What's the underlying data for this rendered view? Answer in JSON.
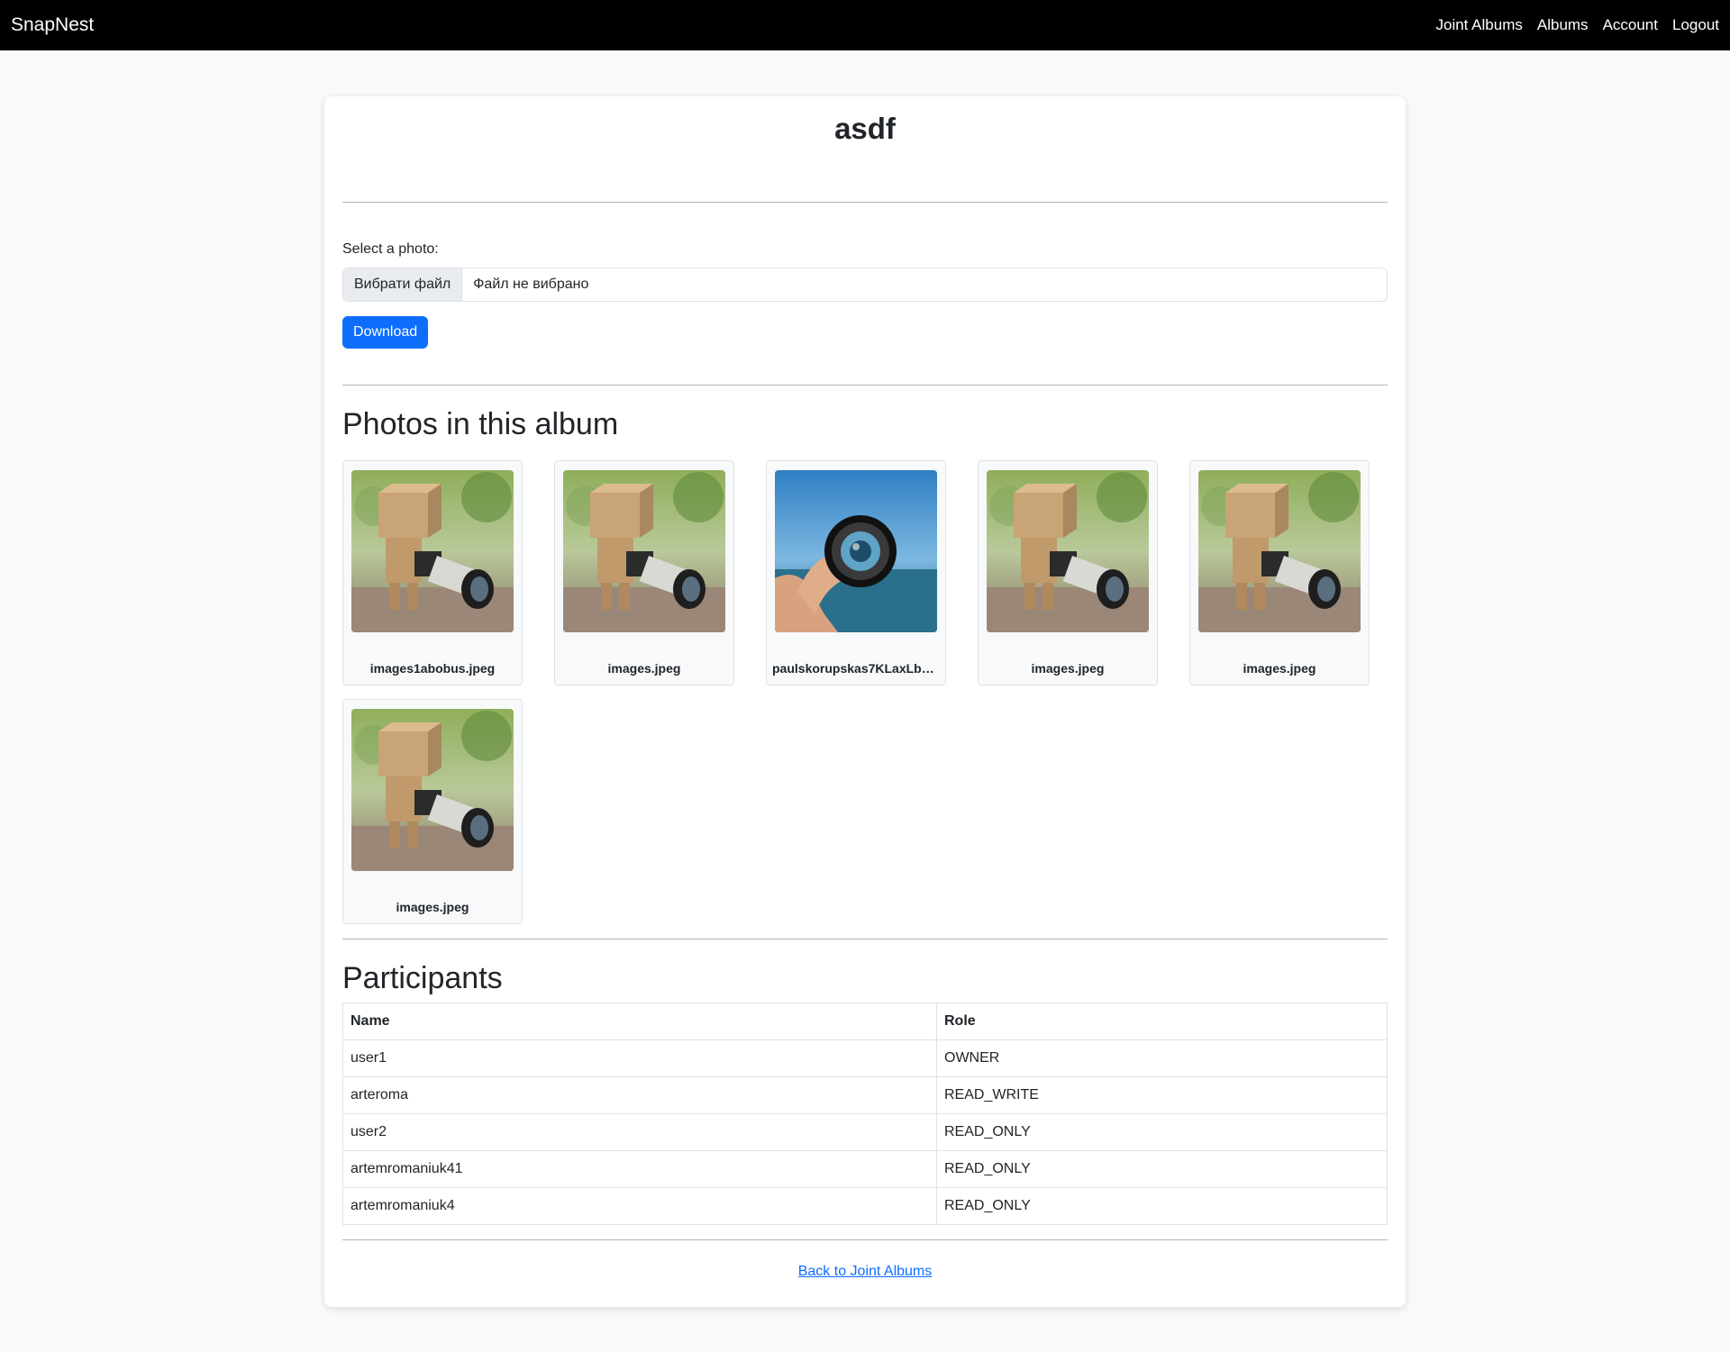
{
  "navbar": {
    "brand": "SnapNest",
    "links": [
      "Joint Albums",
      "Albums",
      "Account",
      "Logout"
    ]
  },
  "album": {
    "title": "asdf"
  },
  "upload": {
    "label": "Select a photo:",
    "choose_button": "Вибрати файл",
    "file_status": "Файл не вибрано",
    "submit_label": "Download"
  },
  "photos": {
    "heading": "Photos in this album",
    "items": [
      {
        "name": "images1abobus.jpeg",
        "image": "cardboard-robot-camera"
      },
      {
        "name": "images.jpeg",
        "image": "cardboard-robot-camera"
      },
      {
        "name": "paulskorupskas7KLaxLbS...",
        "image": "hand-holding-lens"
      },
      {
        "name": "images.jpeg",
        "image": "cardboard-robot-camera"
      },
      {
        "name": "images.jpeg",
        "image": "cardboard-robot-camera"
      },
      {
        "name": "images.jpeg",
        "image": "cardboard-robot-camera"
      }
    ]
  },
  "participants": {
    "heading": "Participants",
    "columns": [
      "Name",
      "Role"
    ],
    "rows": [
      {
        "name": "user1",
        "role": "OWNER"
      },
      {
        "name": "arteroma",
        "role": "READ_WRITE"
      },
      {
        "name": "user2",
        "role": "READ_ONLY"
      },
      {
        "name": "artemromaniuk41",
        "role": "READ_ONLY"
      },
      {
        "name": "artemromaniuk4",
        "role": "READ_ONLY"
      }
    ]
  },
  "footer": {
    "back_link": "Back to Joint Albums"
  },
  "colors": {
    "navbar_bg": "#000000",
    "primary": "#0d6efd",
    "page_bg": "#f8f9fa"
  }
}
